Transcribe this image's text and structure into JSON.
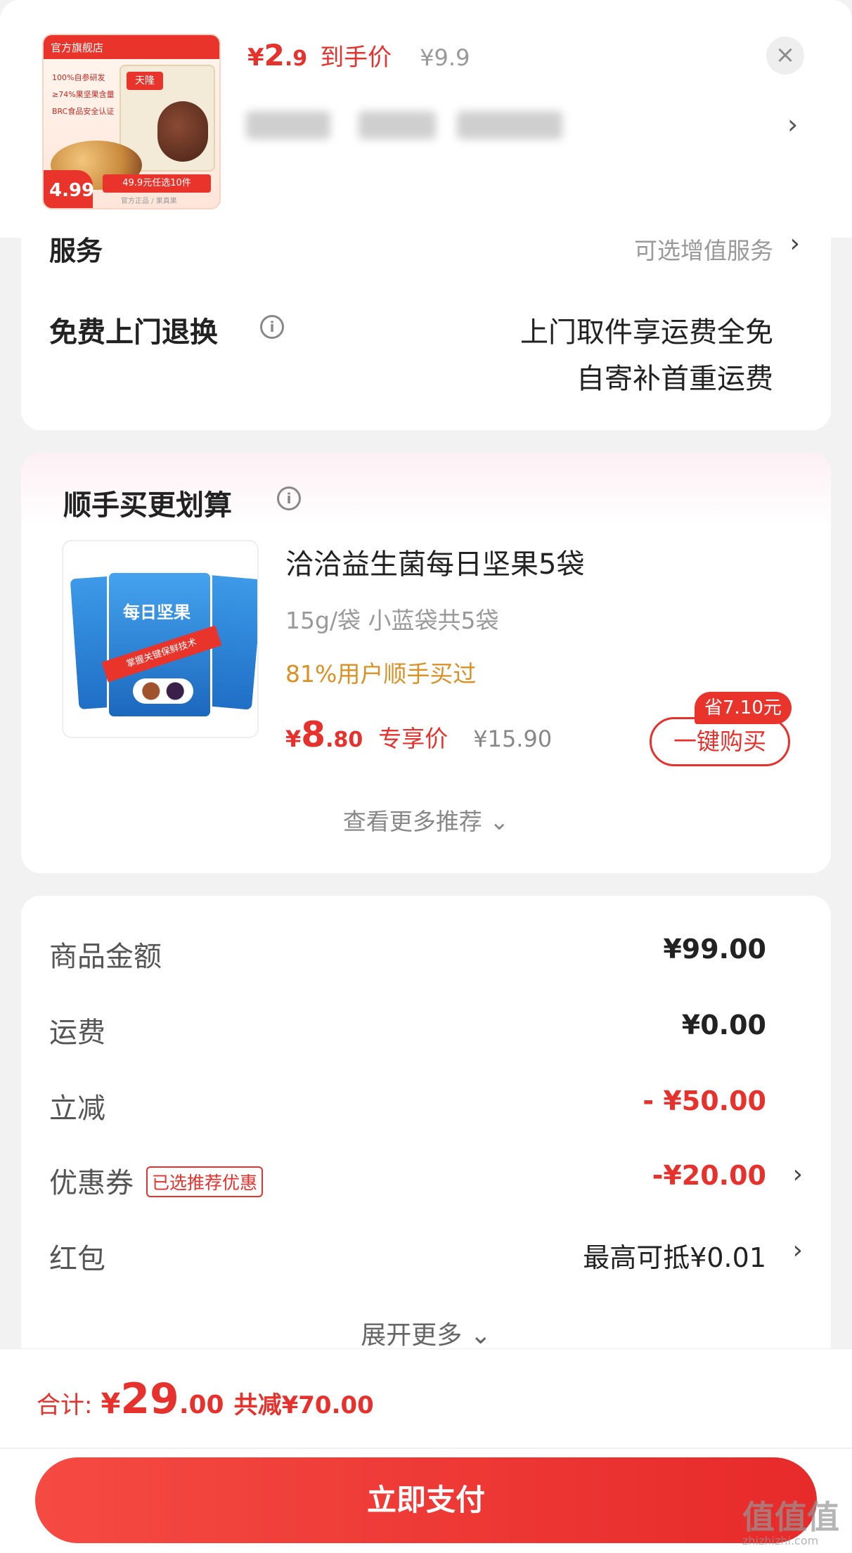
{
  "header": {
    "thumb": {
      "store_badge": "官方旗舰店",
      "features": [
        "100%自参研发",
        "≥74%果坚果含量",
        "BRC食品安全认证"
      ],
      "bag_brand": "天隆",
      "corner_price": "4.99",
      "promo": "49.9元任选10件",
      "footer": "官方正品 / 果真果"
    },
    "price_symbol": "¥",
    "price_int": "2",
    "price_dec": ".9",
    "price_label": "到手价",
    "original_price": "¥9.9",
    "close_icon": "×",
    "more_icon": "›"
  },
  "service": {
    "title": "服务",
    "right_text": "可选增值服务",
    "chevron": "›",
    "return_title": "免费上门退换",
    "return_line1": "上门取件享运费全免",
    "return_line2": "自寄补首重运费"
  },
  "addon": {
    "title": "顺手买更划算",
    "product_image_title": "每日坚果",
    "product_image_band": "掌握关键保鲜技术",
    "product_name": "洽洽益生菌每日坚果5袋",
    "product_spec": "15g/袋 小蓝袋共5袋",
    "social_proof": "81%用户顺手买过",
    "price_symbol": "¥",
    "price_int": "8",
    "price_dec": ".80",
    "price_label": "专享价",
    "original_price": "¥15.90",
    "save_tag": "省7.10元",
    "buy_button": "一键购买",
    "more_link": "查看更多推荐 ⌄"
  },
  "details": {
    "rows": [
      {
        "label": "商品金额",
        "value": "¥99.00"
      },
      {
        "label": "运费",
        "value": "¥0.00"
      },
      {
        "label": "立减",
        "value": "- ¥50.00"
      },
      {
        "label": "优惠券",
        "tag": "已选推荐优惠",
        "value": "-¥20.00"
      },
      {
        "label": "红包",
        "value": "最高可抵¥0.01"
      }
    ],
    "expand": "展开更多 ⌄"
  },
  "footer": {
    "total_label": "合计:",
    "total_symbol": "¥",
    "total_int": "29",
    "total_dec": ".00",
    "total_saved": "共减¥70.00",
    "pay_button": "立即支付",
    "watermark": "值值值",
    "watermark_url": "zhizhizhi.com"
  },
  "colors": {
    "accent": "#e6312c",
    "social_proof": "#d99125",
    "muted": "#999999"
  }
}
